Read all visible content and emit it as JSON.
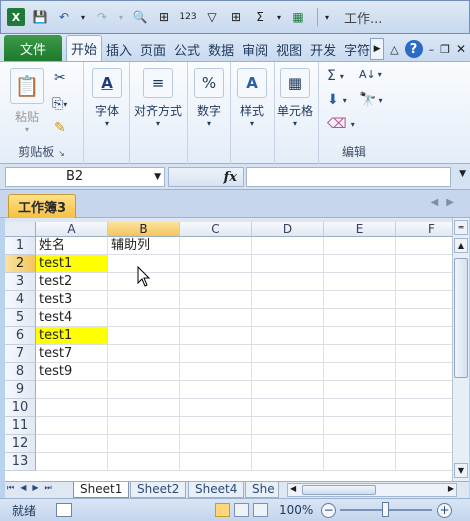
{
  "title_bar": {
    "title": "工作...",
    "colors": {
      "excel_green": "#1f7a3a"
    }
  },
  "ribbon_tabs": {
    "file": "文件",
    "tabs": [
      "开始",
      "插入",
      "页面",
      "公式",
      "数据",
      "审阅",
      "视图",
      "开发",
      "字符"
    ]
  },
  "ribbon": {
    "clipboard": {
      "paste_label": "粘贴",
      "group_label": "剪贴板"
    },
    "font": {
      "label": "字体"
    },
    "alignment": {
      "label": "对齐方式"
    },
    "number": {
      "label": "数字"
    },
    "styles": {
      "label": "样式"
    },
    "cells": {
      "label": "单元格"
    },
    "editing": {
      "group_label": "编辑"
    }
  },
  "formula_bar": {
    "name_box": "B2",
    "fx": "fx",
    "formula": ""
  },
  "workbook": {
    "tab_title": "工作簿3"
  },
  "grid": {
    "columns": [
      "A",
      "B",
      "C",
      "D",
      "E",
      "F"
    ],
    "rows": [
      "1",
      "2",
      "3",
      "4",
      "5",
      "6",
      "7",
      "8",
      "9",
      "10",
      "11",
      "12",
      "13"
    ],
    "cells": {
      "A1": "姓名",
      "B1": "辅助列",
      "A2": "test1",
      "A3": "test2",
      "A4": "test3",
      "A5": "test4",
      "A6": "test1",
      "A7": "test7",
      "A8": "test9"
    },
    "highlight_color": "#ffff00"
  },
  "sheets": {
    "tabs": [
      "Sheet1",
      "Sheet2",
      "Sheet4",
      "She"
    ]
  },
  "status": {
    "ready": "就绪",
    "zoom": "100%"
  }
}
